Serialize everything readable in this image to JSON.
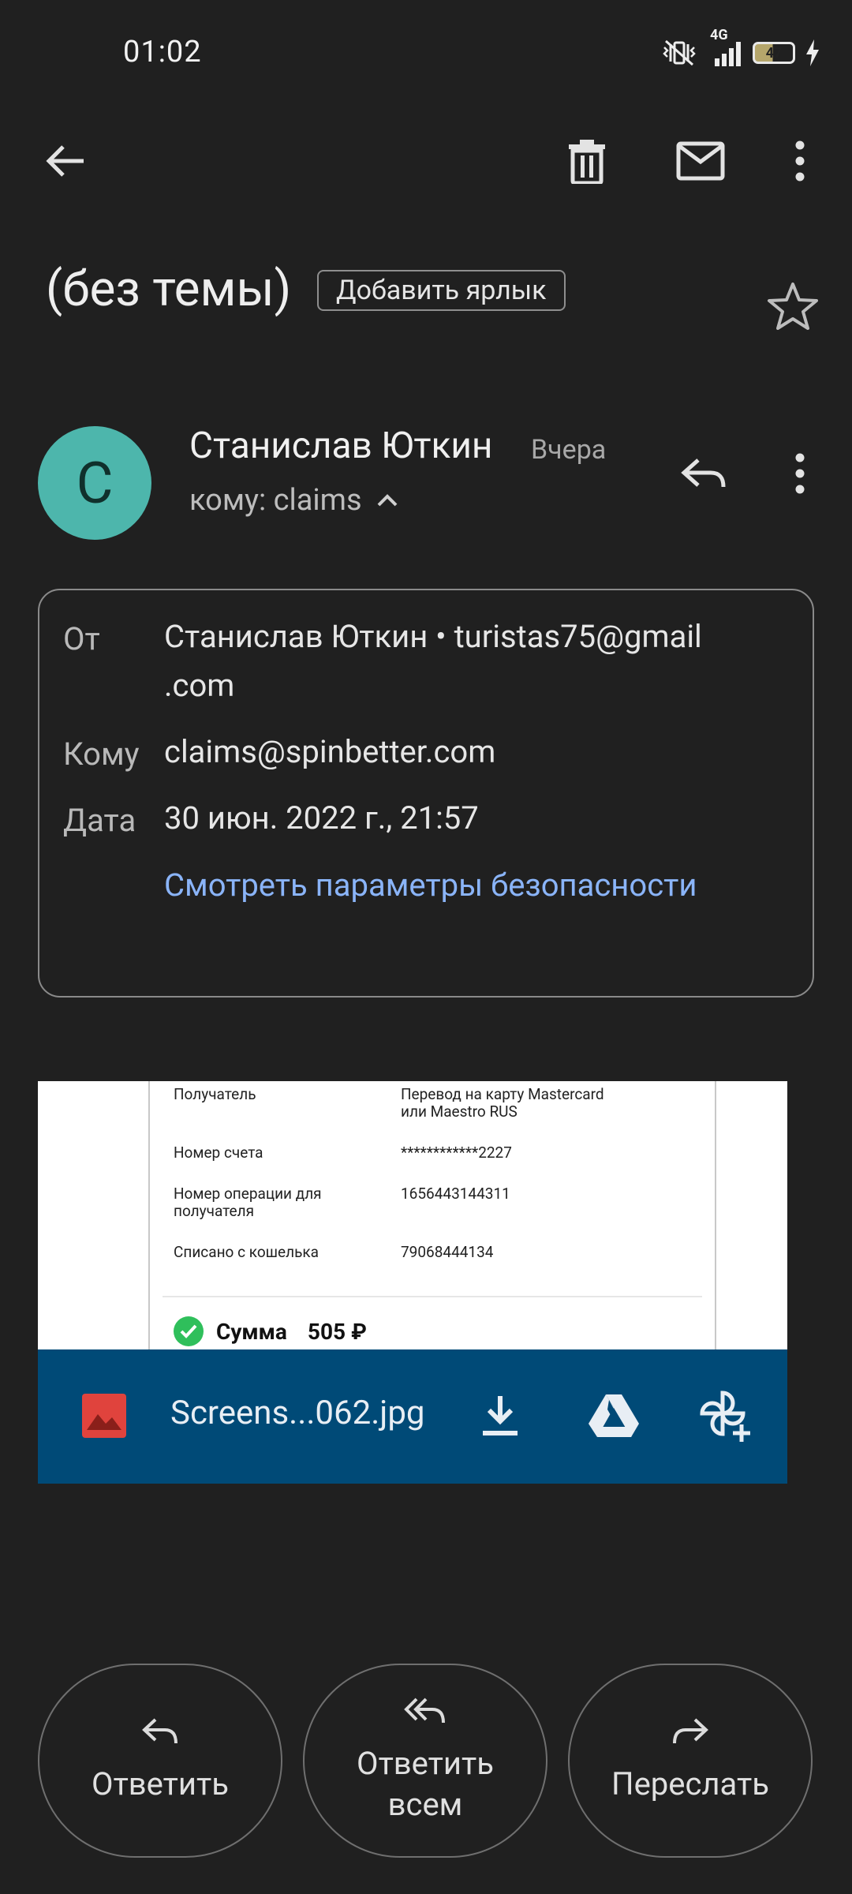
{
  "status_bar": {
    "time": "01:02",
    "network": "4G",
    "battery": "47"
  },
  "message": {
    "subject": "(без темы)",
    "add_label": "Добавить ярлык",
    "sender_initial": "С",
    "sender_name": "Станислав Юткин",
    "date_short": "Вчера",
    "to_summary": "кому: claims",
    "details": {
      "from_label": "От",
      "from_value_line1": "Станислав Юткин • turistas75@gmail",
      "from_value_line2": ".com",
      "to_label": "Кому",
      "to_value": "claims@spinbetter.com",
      "date_label": "Дата",
      "date_value": "30 июн. 2022 г., 21:57",
      "security_link": "Смотреть параметры безопасности"
    }
  },
  "attachment": {
    "filename": "Screens...062.jpg",
    "preview": {
      "recipient_label": "Получатель",
      "recipient_value_line1": "Перевод на карту Mastercard",
      "recipient_value_line2": "или Maestro RUS",
      "account_label": "Номер счета",
      "account_value": "************2227",
      "operation_label_line1": "Номер операции для",
      "operation_label_line2": "получателя",
      "operation_value": "1656443144311",
      "wallet_label": "Списано с кошелька",
      "wallet_value": "79068444134",
      "sum_label": "Сумма",
      "sum_value": "505 ₽"
    }
  },
  "actions": {
    "reply": "Ответить",
    "reply_all_line1": "Ответить",
    "reply_all_line2": "всем",
    "forward": "Переслать"
  },
  "colors": {
    "background": "#202020",
    "avatar": "#4db6ac",
    "link": "#8ab4f8",
    "attachment_bar": "#004a77",
    "image_icon": "#e0433d",
    "check_green": "#2fbf5b"
  }
}
